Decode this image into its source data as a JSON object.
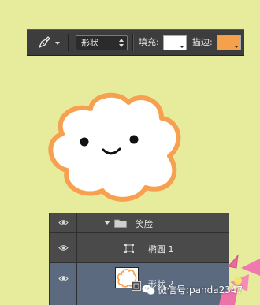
{
  "toolbar": {
    "tool_icon": "pen-icon",
    "mode_value": "形状",
    "fill_label": "填充:",
    "fill_color": "#ffffff",
    "stroke_label": "描边:",
    "stroke_color": "#f5a04a"
  },
  "canvas": {
    "flower_fill": "#ffffff",
    "flower_stroke": "#f7a050",
    "background": "#e7eb9c"
  },
  "layers": {
    "rows": [
      {
        "name": "笑脸",
        "type": "group",
        "visible": true
      },
      {
        "name": "椭圆 1",
        "type": "shape",
        "visible": true
      },
      {
        "name": "形状 2",
        "type": "shape",
        "visible": true,
        "selected": true
      }
    ]
  },
  "watermark": {
    "icon": "wechat-icon",
    "text": "微信号:panda2347"
  }
}
